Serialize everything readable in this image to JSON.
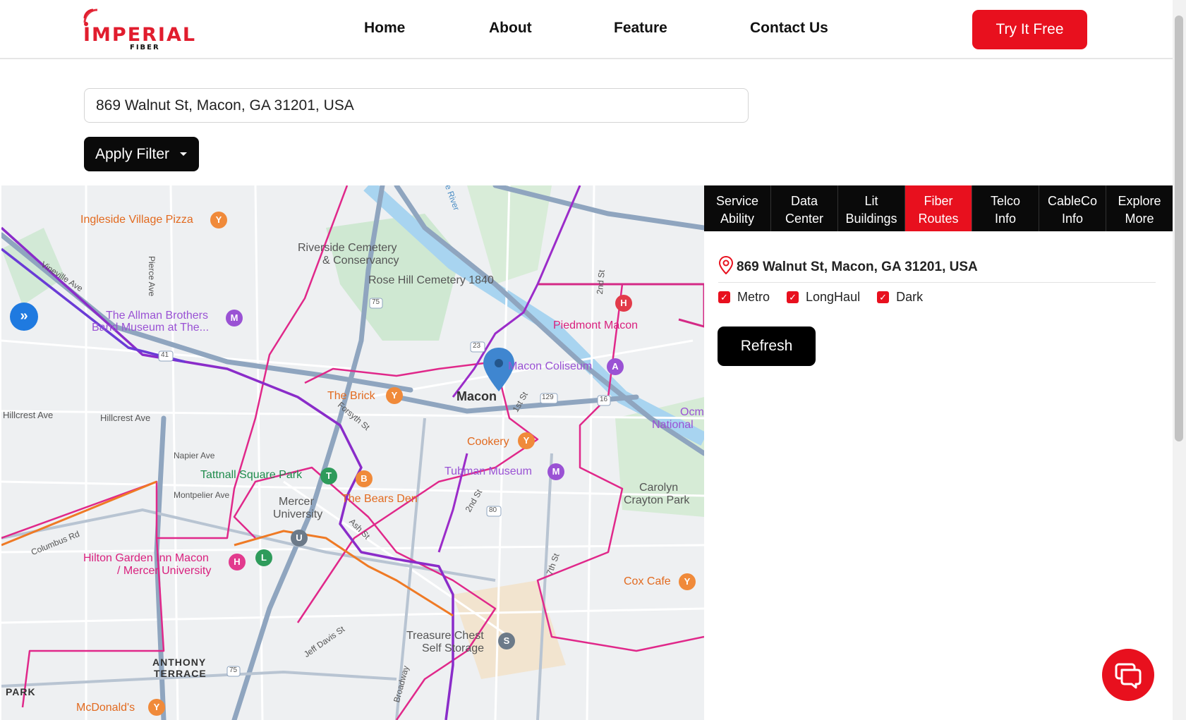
{
  "brand": {
    "name": "IMPERIAL",
    "sub": "FIBER",
    "color": "#e8101e"
  },
  "nav": {
    "items": [
      "Home",
      "About",
      "Feature",
      "Contact Us"
    ],
    "cta": "Try It Free"
  },
  "search": {
    "value": "869 Walnut St, Macon, GA 31201, USA"
  },
  "filter": {
    "label": "Apply Filter"
  },
  "map": {
    "labels": {
      "ingleside": "Ingleside Village Pizza",
      "riverside1": "Riverside Cemetery",
      "riverside2": "& Conservancy",
      "rosehill": "Rose Hill Cemetery 1840",
      "allman1": "The Allman Brothers",
      "allman2": "Band Museum at The...",
      "piedmont": "Piedmont Macon",
      "coliseum": "Macon Coliseum",
      "macon": "Macon",
      "brick": "The Brick",
      "cookery": "Cookery",
      "tattnall": "Tattnall Square Park",
      "bearsden": "The Bears Den",
      "tubman": "Tubman Museum",
      "mercer1": "Mercer",
      "mercer2": "University",
      "ocm1": "Ocm",
      "ocm2": "National",
      "carolyn1": "Carolyn",
      "carolyn2": "Crayton Park",
      "hilton1": "Hilton Garden Inn Macon",
      "hilton2": "/ Mercer University",
      "coxcafe": "Cox Cafe",
      "treasure1": "Treasure Chest",
      "treasure2": "Self Storage",
      "anthony1": "ANTHONY",
      "anthony2": "TERRACE",
      "park": "PARK",
      "mcdonalds": "McDonald's",
      "hillcrest1": "Hillcrest Ave",
      "hillcrest2": "Hillcrest Ave",
      "napier": "Napier Ave",
      "montpelier": "Montpelier Ave",
      "pierce": "Pierce Ave",
      "forsyth": "Forsyth St",
      "vineville": "Vineville Ave",
      "ash": "Ash St",
      "first": "1st St",
      "second": "2nd St",
      "second2": "2nd St",
      "seventh": "7th St",
      "columbus": "Columbus Rd",
      "jeffdavis": "Jeff Davis St",
      "broadway": "Broadway",
      "river": "e River",
      "hwy75": "75",
      "hwy41": "41",
      "hwy23": "23",
      "hwy129": "129",
      "hwy16": "16",
      "hwy80": "80",
      "hwy75b": "75"
    }
  },
  "panel": {
    "tabs": [
      {
        "l1": "Service",
        "l2": "Ability"
      },
      {
        "l1": "Data",
        "l2": "Center"
      },
      {
        "l1": "Lit",
        "l2": "Buildings"
      },
      {
        "l1": "Fiber",
        "l2": "Routes"
      },
      {
        "l1": "Telco",
        "l2": "Info"
      },
      {
        "l1": "CableCo",
        "l2": "Info"
      },
      {
        "l1": "Explore",
        "l2": "More"
      }
    ],
    "active_tab": "Fiber Routes",
    "address": "869 Walnut St, Macon, GA 31201, USA",
    "checks": [
      "Metro",
      "LongHaul",
      "Dark"
    ],
    "refresh": "Refresh"
  },
  "icons": {
    "logo": "wifi-signal-icon",
    "caret": "caret-down-icon",
    "expand": "double-chevron-right-icon",
    "pin": "location-pin-icon",
    "check": "checkmark-icon",
    "chat": "chat-bubbles-icon"
  }
}
